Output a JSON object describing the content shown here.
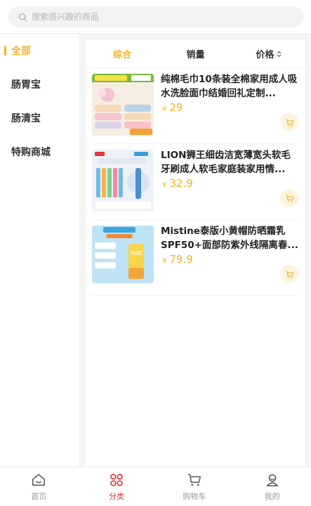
{
  "search": {
    "placeholder": "搜索感兴趣的商品"
  },
  "sidebar": {
    "items": [
      {
        "label": "全部",
        "active": true
      },
      {
        "label": "肠胃宝",
        "active": false
      },
      {
        "label": "肠清宝",
        "active": false
      },
      {
        "label": "特购商城",
        "active": false
      }
    ]
  },
  "sort": {
    "comprehensive": "综合",
    "sales": "销量",
    "price": "价格"
  },
  "products": [
    {
      "title": "纯棉毛巾10条装全棉家用成人吸水洗脸面巾结婚回礼定制...",
      "yen": "¥",
      "price": "29",
      "image": "towel-product-image"
    },
    {
      "title": "LION狮王细齿洁宽薄宽头软毛牙刷成人软毛家庭装家用情...",
      "yen": "¥",
      "price": "32.9",
      "image": "toothbrush-product-image"
    },
    {
      "title": "Mistine泰版小黄帽防晒霜乳SPF50+面部防紫外线隔离春...",
      "yen": "¥",
      "price": "79.9",
      "image": "sunscreen-product-image"
    }
  ],
  "tabs": [
    {
      "label": "首页",
      "icon": "home-icon",
      "active": false
    },
    {
      "label": "分类",
      "icon": "category-icon",
      "active": true
    },
    {
      "label": "购物车",
      "icon": "cart-icon",
      "active": false
    },
    {
      "label": "我的",
      "icon": "profile-icon",
      "active": false
    }
  ],
  "colors": {
    "accent": "#f5b324",
    "tab_active": "#e0303a"
  }
}
